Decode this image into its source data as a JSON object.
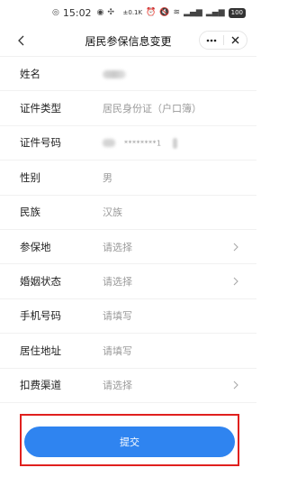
{
  "status_bar": {
    "time": "15:02",
    "net_speed": "0.1K",
    "battery": "100"
  },
  "nav": {
    "title": "居民参保信息变更",
    "more_icon": "ellipsis-icon",
    "close_icon": "close-icon",
    "back_icon": "chevron-left-icon"
  },
  "form": {
    "rows": [
      {
        "label": "姓名",
        "value": ""
      },
      {
        "label": "证件类型",
        "value": "居民身份证（户口簿）"
      },
      {
        "label": "证件号码",
        "value": "********1"
      },
      {
        "label": "性别",
        "value": "男"
      },
      {
        "label": "民族",
        "value": "汉族"
      },
      {
        "label": "参保地",
        "value": "请选择"
      },
      {
        "label": "婚姻状态",
        "value": "请选择"
      },
      {
        "label": "手机号码",
        "value": "请填写"
      },
      {
        "label": "居住地址",
        "value": "请填写"
      },
      {
        "label": "扣费渠道",
        "value": "请选择"
      }
    ]
  },
  "submit": {
    "label": "提交",
    "color": "#2f84f0",
    "highlight_color": "#e0201e"
  }
}
